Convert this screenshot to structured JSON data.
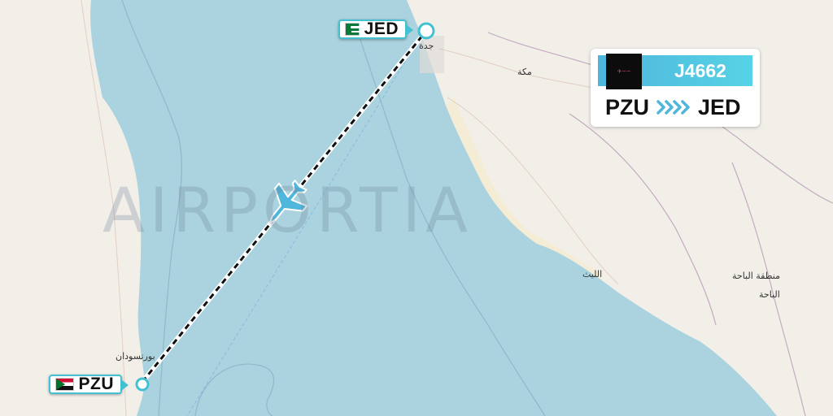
{
  "flight": {
    "number": "J4662",
    "origin": "PZU",
    "destination": "JED"
  },
  "airports": {
    "origin": {
      "code": "PZU",
      "flag": "sudan-flag-icon"
    },
    "destination": {
      "code": "JED",
      "flag": "saudi-arabia-flag-icon"
    }
  },
  "watermark": "AIRPORTIA",
  "map_labels": {
    "jeddah": "جدة",
    "mecca": "مكة",
    "port_sudan": "بورتسودان",
    "al_lith": "الليث",
    "al_baha_region": "منطقة الباحة",
    "al_baha": "الباحة"
  },
  "colors": {
    "sea": "#aad3df",
    "land": "#f2efe9",
    "accent": "#43c1d2",
    "route": "#111111",
    "plane": "#4fb6dc"
  }
}
